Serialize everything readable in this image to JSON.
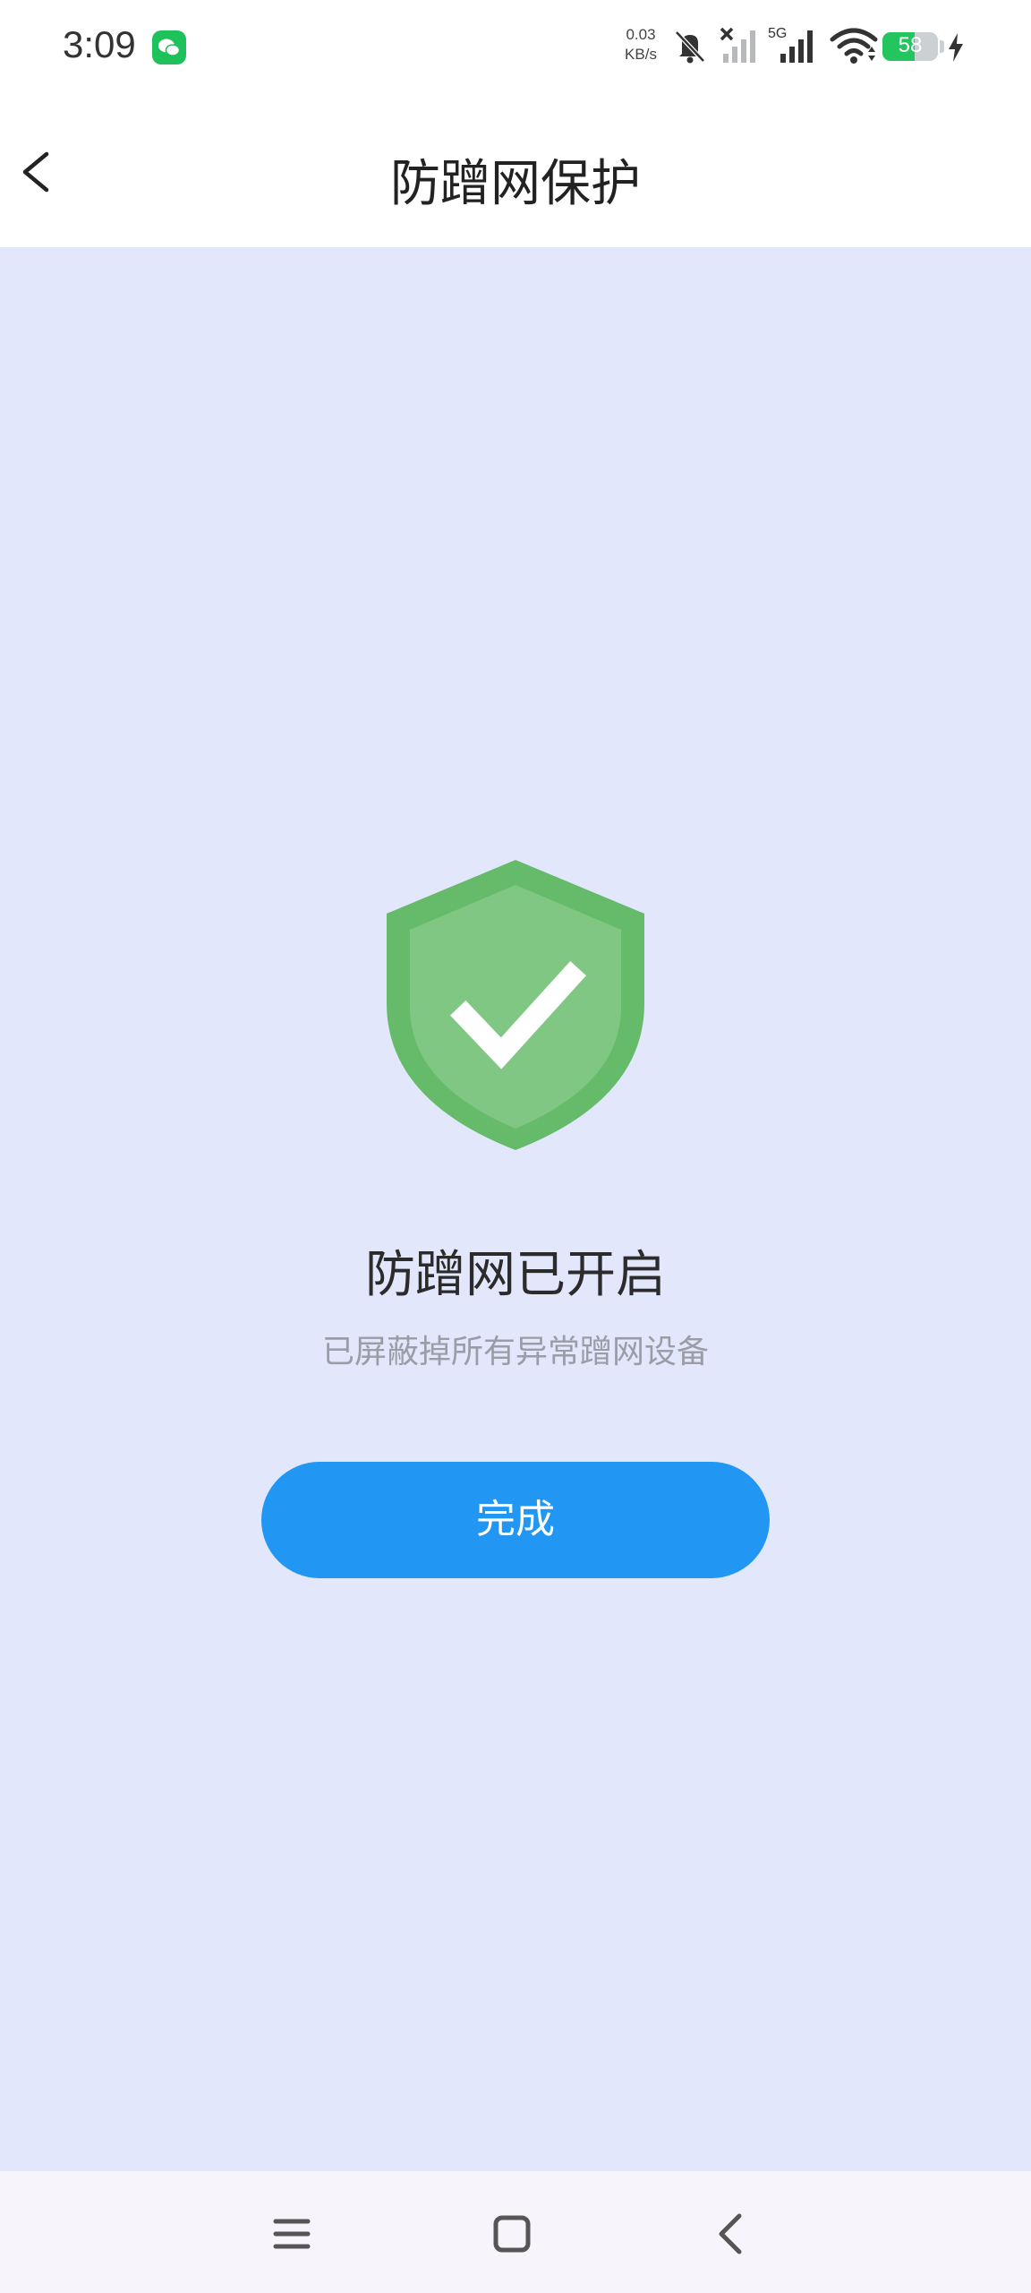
{
  "status_bar": {
    "time": "3:09",
    "net_speed_value": "0.03",
    "net_speed_unit": "KB/s",
    "network_type": "5G",
    "battery_level": "58",
    "battery_fraction": 0.58,
    "icons": [
      "wechat-icon",
      "mute-icon",
      "no-signal-icon",
      "signal-icon",
      "wifi-icon",
      "charging-icon"
    ]
  },
  "header": {
    "title": "防蹭网保护"
  },
  "main": {
    "heading": "防蹭网已开启",
    "subtitle": "已屏蔽掉所有异常蹭网设备",
    "done_button": "完成"
  },
  "colors": {
    "background": "#e3e7fc",
    "shield_outer": "#66bb6a",
    "shield_inner": "#81c784",
    "primary_button": "#2196f3",
    "battery": "#22c55e"
  }
}
